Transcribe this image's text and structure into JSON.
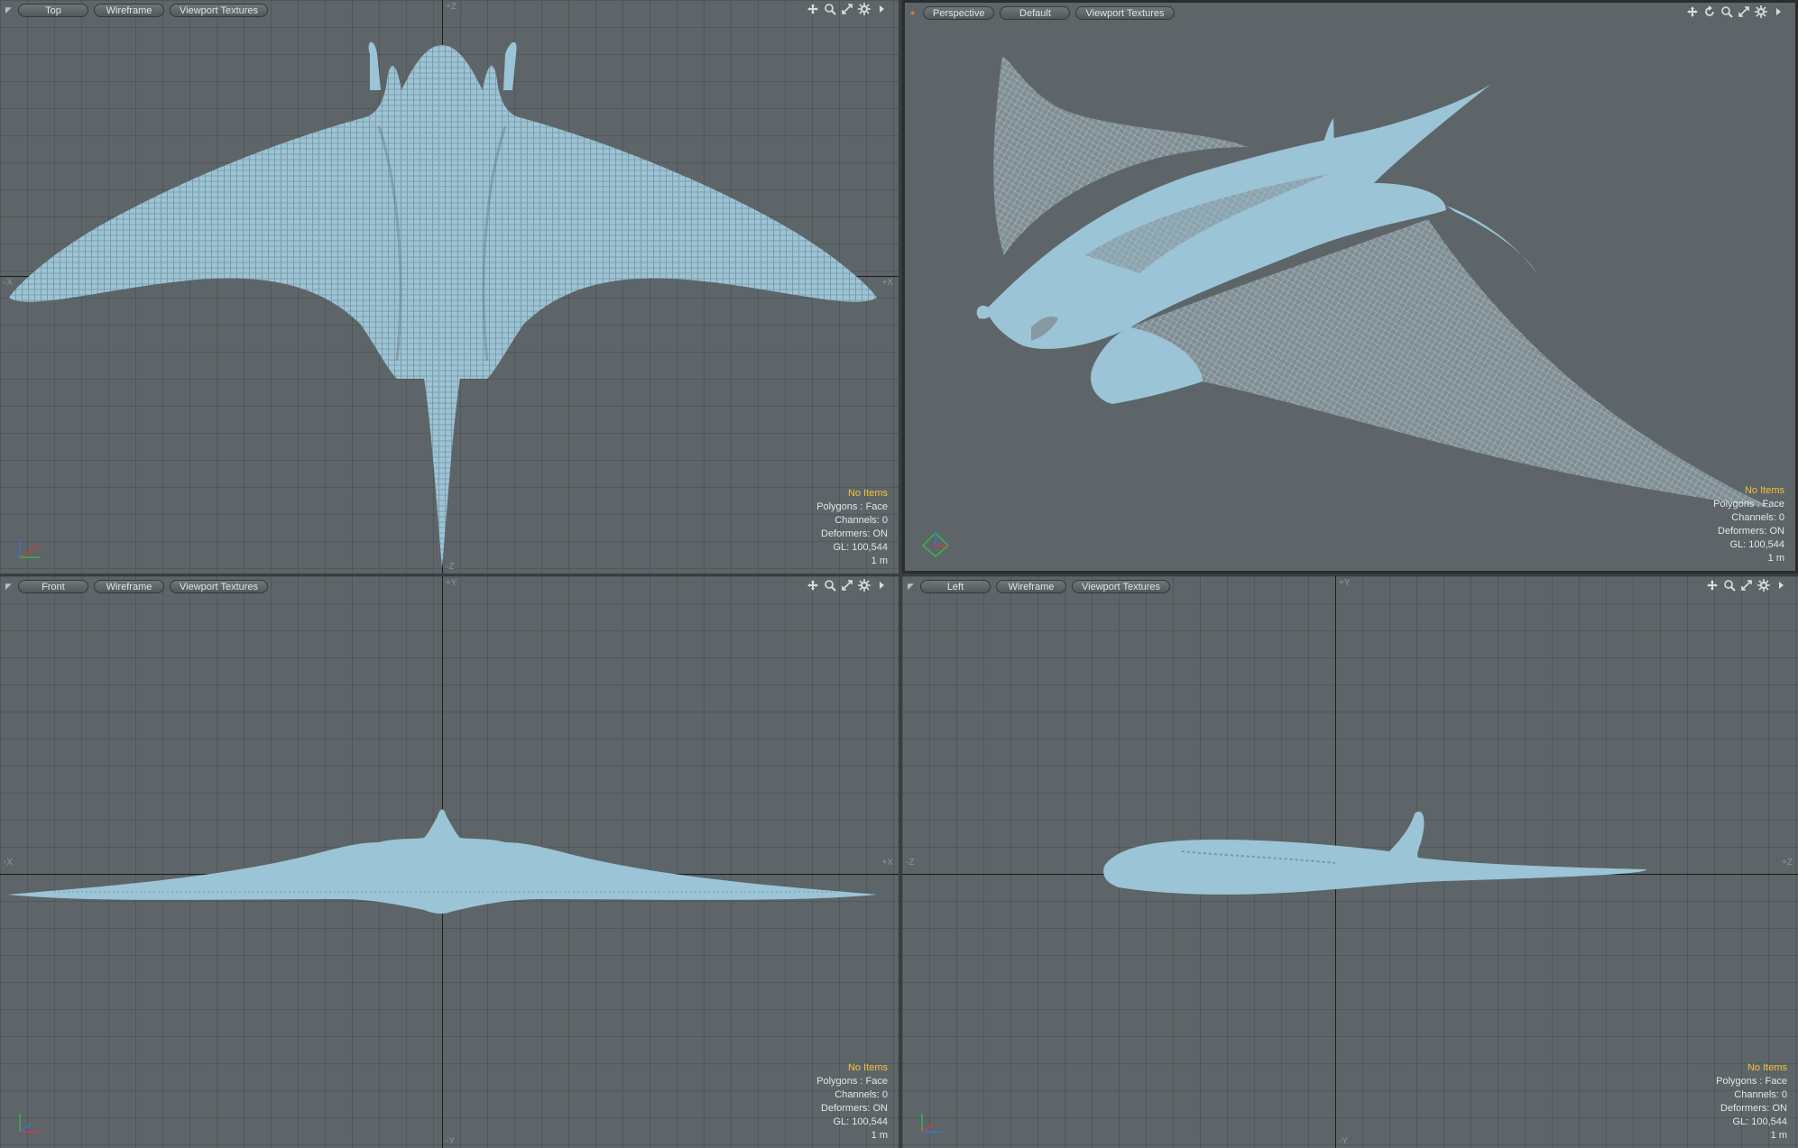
{
  "viewports": {
    "top": {
      "view_label": "Top",
      "shading_label": "Wireframe",
      "texture_label": "Viewport Textures",
      "axis_left": "-X",
      "axis_right": "+X",
      "axis_top": "+Z",
      "axis_bottom": "-Z",
      "stats": {
        "items": "No Items",
        "polygons": "Polygons : Face",
        "channels": "Channels: 0",
        "deformers": "Deformers: ON",
        "gl": "GL: 100,544",
        "scale": "1 m"
      }
    },
    "perspective": {
      "view_label": "Perspective",
      "shading_label": "Default",
      "texture_label": "Viewport Textures",
      "stats": {
        "items": "No Items",
        "polygons": "Polygons : Face",
        "channels": "Channels: 0",
        "deformers": "Deformers: ON",
        "gl": "GL: 100,544",
        "scale": "1 m"
      }
    },
    "front": {
      "view_label": "Front",
      "shading_label": "Wireframe",
      "texture_label": "Viewport Textures",
      "axis_left": "-X",
      "axis_right": "+X",
      "axis_top": "+Y",
      "axis_bottom": "-Y",
      "stats": {
        "items": "No Items",
        "polygons": "Polygons : Face",
        "channels": "Channels: 0",
        "deformers": "Deformers: ON",
        "gl": "GL: 100,544",
        "scale": "1 m"
      }
    },
    "left": {
      "view_label": "Left",
      "shading_label": "Wireframe",
      "texture_label": "Viewport Textures",
      "axis_left": "-Z",
      "axis_right": "+Z",
      "axis_top": "+Y",
      "axis_bottom": "-Y",
      "stats": {
        "items": "No Items",
        "polygons": "Polygons : Face",
        "channels": "Channels: 0",
        "deformers": "Deformers: ON",
        "gl": "GL: 100,544",
        "scale": "1 m"
      }
    }
  },
  "colors": {
    "viewport_bg": "#5d6569",
    "mesh": "#9bc4d6",
    "highlight_text": "#f3c13a"
  },
  "icons": [
    "move-icon",
    "rotate-icon",
    "zoom-icon",
    "maximize-icon",
    "gear-icon",
    "arrow-right-icon"
  ]
}
